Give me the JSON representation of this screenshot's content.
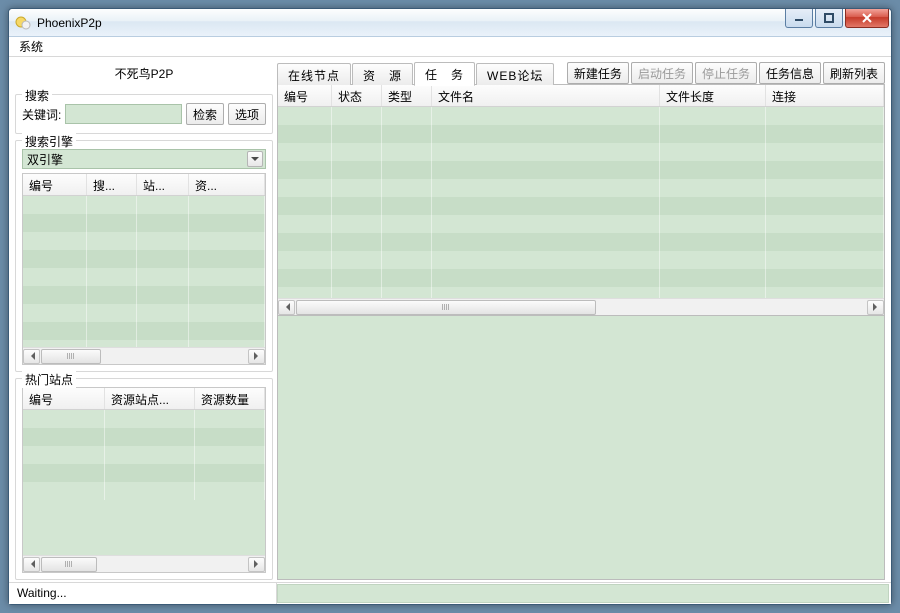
{
  "titlebar": {
    "title": "PhoenixP2p"
  },
  "menu": {
    "system": "系统"
  },
  "brand": "不死鸟P2P",
  "search": {
    "legend": "搜索",
    "keyword_label": "关键词:",
    "search_btn": "检索",
    "options_btn": "选项"
  },
  "engine": {
    "legend": "搜索引擎",
    "value": "双引擎"
  },
  "search_grid": {
    "cols": [
      "编号",
      "搜...",
      "站...",
      "资..."
    ]
  },
  "hot": {
    "legend": "热门站点",
    "cols": [
      "编号",
      "资源站点...",
      "资源数量"
    ]
  },
  "tabs": [
    "在线节点",
    "资　源",
    "任　务",
    "WEB论坛"
  ],
  "active_tab_index": 2,
  "toolbar": {
    "new": "新建任务",
    "start": "启动任务",
    "stop": "停止任务",
    "info": "任务信息",
    "refresh": "刷新列表"
  },
  "task_grid": {
    "cols": [
      "编号",
      "状态",
      "类型",
      "文件名",
      "文件长度",
      "连接"
    ]
  },
  "status": {
    "waiting": "Waiting..."
  }
}
